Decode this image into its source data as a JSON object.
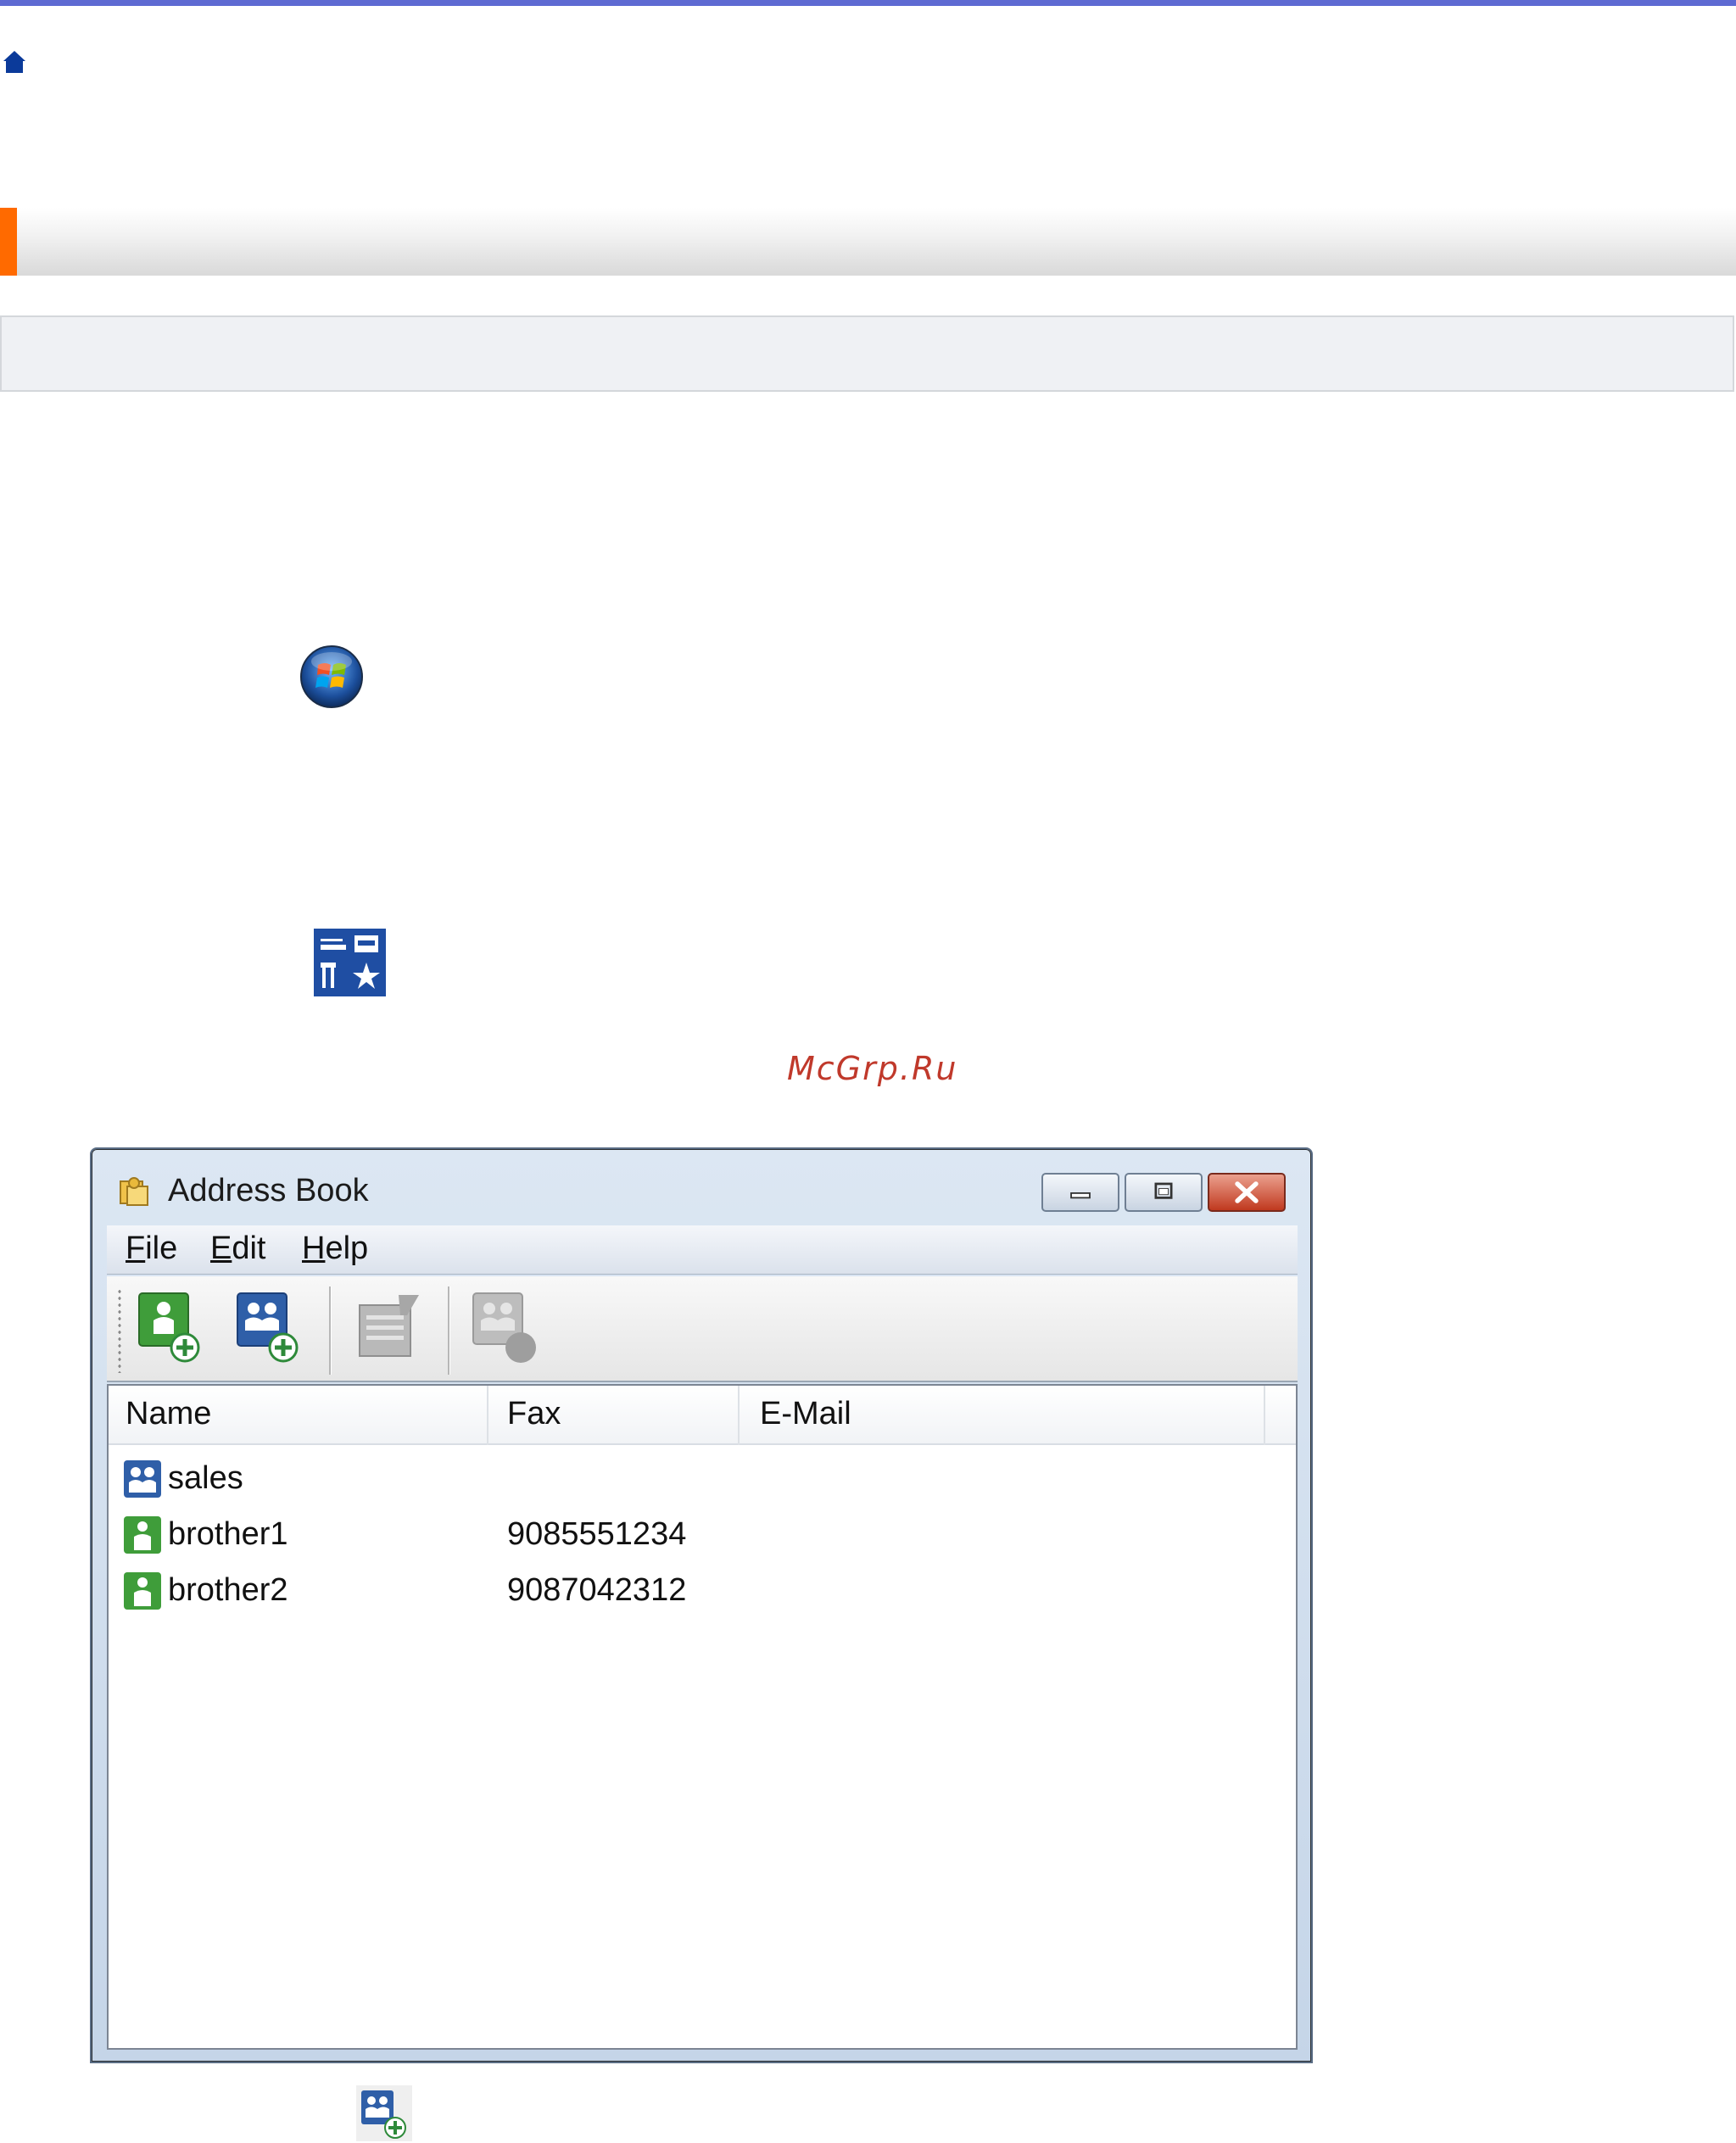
{
  "watermark": "McGrp.Ru",
  "window": {
    "title": "Address Book",
    "menu": [
      {
        "key": "F",
        "rest": "ile"
      },
      {
        "key": "E",
        "rest": "dit"
      },
      {
        "key": "H",
        "rest": "elp"
      }
    ]
  },
  "list": {
    "columns": [
      "Name",
      "Fax",
      "E-Mail"
    ],
    "rows": [
      {
        "name": "sales",
        "fax": "",
        "type": "group"
      },
      {
        "name": "brother1",
        "fax": "9085551234",
        "type": "member"
      },
      {
        "name": "brother2",
        "fax": "9087042312",
        "type": "member"
      }
    ]
  },
  "colors": {
    "top_rule": "#5e6ad2",
    "heading_accent": "#ff6a00",
    "watermark": "#c0392b",
    "member_icon": "#3f9d3a",
    "group_icon": "#2f5fa8"
  },
  "icons": {
    "home": "home-icon",
    "start": "windows-start-orb-icon",
    "tools": "brother-utilities-icon",
    "window": "address-book-icon",
    "add_member": "add-member-icon",
    "add_group": "add-group-icon",
    "edit": "edit-entry-icon",
    "send": "send-fax-icon"
  }
}
